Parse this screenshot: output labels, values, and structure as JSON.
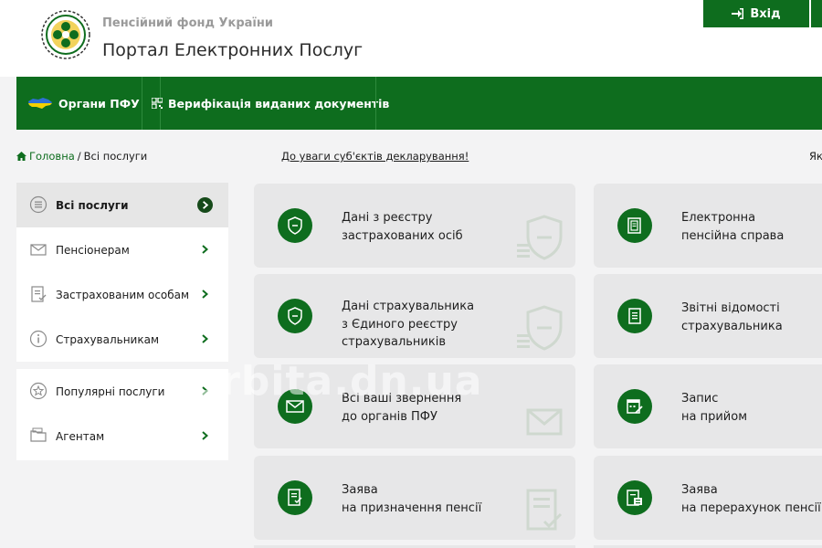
{
  "header": {
    "org_name": "Пенсійний фонд України",
    "portal_title": "Портал Електронних Послуг",
    "login_label": "Вхід",
    "login_icon": "sign-in-icon",
    "logo_icon": "pfu-emblem-icon"
  },
  "nav": {
    "items": [
      {
        "label": "Органи ПФУ",
        "icon": "ukraine-map-icon"
      },
      {
        "label": "Верифікація виданих документів",
        "icon": "qr-code-icon"
      }
    ]
  },
  "breadcrumb": {
    "home": "Головна",
    "separator": "/",
    "current": "Всі послуги"
  },
  "notice_link": "До уваги суб'єктів декларування!",
  "edge_text": "Як",
  "sidebar": {
    "group1": [
      {
        "label": "Всі послуги",
        "icon": "list-icon",
        "active": true
      },
      {
        "label": "Пенсіонерам",
        "icon": "envelope-icon"
      },
      {
        "label": "Застрахованим особам",
        "icon": "document-check-icon"
      },
      {
        "label": "Страхувальникам",
        "icon": "info-icon"
      }
    ],
    "group2": [
      {
        "label": "Популярні послуги",
        "icon": "star-icon"
      },
      {
        "label": "Агентам",
        "icon": "folder-icon"
      }
    ]
  },
  "services": {
    "left": [
      {
        "line1": "Дані з реєстру",
        "line2": "застрахованих осіб",
        "line3": "",
        "icon": "shield-coins-icon"
      },
      {
        "line1": "Дані страхувальника",
        "line2": "з Єдиного реєстру",
        "line3": "страхувальників",
        "icon": "shield-coins-icon"
      },
      {
        "line1": "Всі ваші звернення",
        "line2": "до органів ПФУ",
        "line3": "",
        "icon": "envelope-icon"
      },
      {
        "line1": "Заява",
        "line2": "на призначення пенсії",
        "line3": "",
        "icon": "form-check-icon"
      }
    ],
    "right": [
      {
        "line1": "Електронна",
        "line2": "пенсійна справа",
        "icon": "folder-doc-icon"
      },
      {
        "line1": "Звітні відомості",
        "line2": "страхувальника",
        "icon": "report-icon"
      },
      {
        "line1": "Запис",
        "line2": "на прийом",
        "icon": "calendar-edit-icon"
      },
      {
        "line1": "Заява",
        "line2": "на перерахунок пенсії",
        "icon": "doc-recalc-icon"
      }
    ]
  },
  "watermark_text": "orbita.dn.ua",
  "colors": {
    "brand_green": "#0e6d1e",
    "dark_green": "#164a1a",
    "background": "#f3f3f4",
    "card": "#e7e7e8"
  }
}
